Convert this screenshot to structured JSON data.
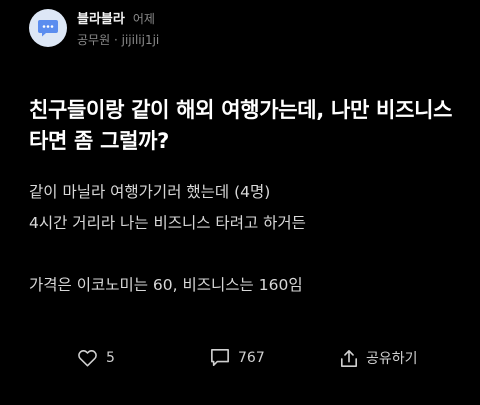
{
  "post": {
    "channel_name": "블라블라",
    "time": "어제",
    "author_company": "공무원",
    "separator": "·",
    "author_nick": "jijilij1ji",
    "title": "친구들이랑 같이 해외 여행가는데, 나만 비즈니스 타면 좀 그럴까?",
    "body_lines": [
      "같이 마닐라 여행가기러 했는데 (4명)",
      "4시간 거리라 나는 비즈니스 타려고 하거든",
      "가격은 이코노미는 60, 비즈니스는 160임"
    ]
  },
  "actions": {
    "like_count": "5",
    "comment_count": "767",
    "share_label": "공유하기"
  },
  "icons": {
    "avatar": "chat-bubble-icon",
    "like": "heart-icon",
    "comment": "comment-icon",
    "share": "share-icon"
  },
  "colors": {
    "background": "#000000",
    "avatar_bg": "#dde7f6",
    "avatar_icon": "#5b8def",
    "muted_text": "#8b8b8b"
  }
}
